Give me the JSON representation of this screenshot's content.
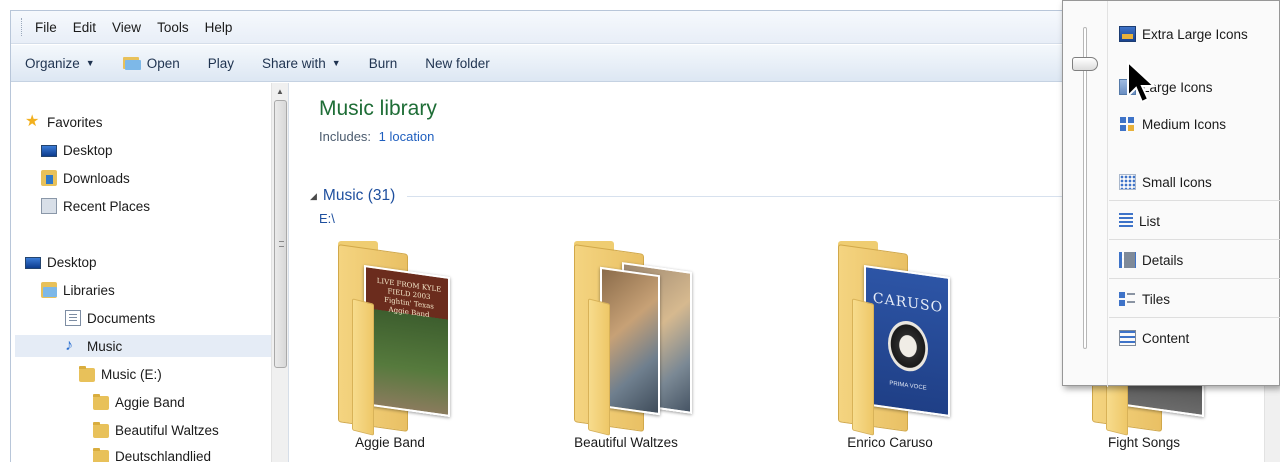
{
  "menu": [
    "File",
    "Edit",
    "View",
    "Tools",
    "Help"
  ],
  "toolbar": {
    "organize": "Organize",
    "open": "Open",
    "play": "Play",
    "share_with": "Share with",
    "burn": "Burn",
    "new_folder": "New folder"
  },
  "nav": {
    "favorites": "Favorites",
    "fav_desktop": "Desktop",
    "downloads": "Downloads",
    "recent_places": "Recent Places",
    "desktop": "Desktop",
    "libraries": "Libraries",
    "documents": "Documents",
    "music": "Music",
    "music_drive": "Music (E:)",
    "aggie_band": "Aggie Band",
    "beautiful_waltzes": "Beautiful Waltzes",
    "deutschlandlied": "Deutschlandlied"
  },
  "library": {
    "title": "Music library",
    "includes_label": "Includes:",
    "includes_link": "1 location"
  },
  "group": {
    "name": "Music (31)",
    "path": "E:\\"
  },
  "folders": {
    "aggie": "Aggie Band",
    "waltzes": "Beautiful Waltzes",
    "caruso": "Enrico Caruso",
    "fight": "Fight Songs"
  },
  "covers": {
    "aggie_text": "LIVE FROM KYLE FIELD 2003 Fightin' Texas Aggie Band",
    "caruso_text": "CARUSO",
    "caruso_sub": "PRIMA VOCE"
  },
  "view_menu": {
    "extra_large": "Extra Large Icons",
    "large": "Large Icons",
    "medium": "Medium Icons",
    "small": "Small Icons",
    "list": "List",
    "details": "Details",
    "tiles": "Tiles",
    "content": "Content"
  },
  "icons": {
    "favorites": "star-icon",
    "music": "music-note-icon",
    "folder": "folder-icon",
    "view_slider": "slider-icon"
  }
}
